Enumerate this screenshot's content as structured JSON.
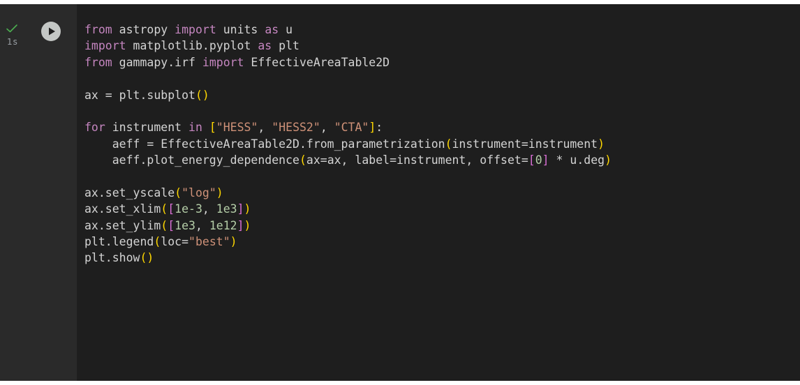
{
  "cell": {
    "status": "success",
    "exec_time": "1s",
    "run_button_icon": "play-icon",
    "check_icon": "check-icon",
    "colors": {
      "background": "#1e1e1e",
      "gutter": "#2a2a2a",
      "keyword": "#c586c0",
      "string": "#ce9178",
      "number": "#b5cea8",
      "bracket_level1": "#ffd700",
      "bracket_level2": "#da70d6",
      "check": "#4caf50"
    },
    "code_lines": [
      [
        {
          "t": "kw",
          "v": "from"
        },
        {
          "t": "id",
          "v": " astropy "
        },
        {
          "t": "kw",
          "v": "import"
        },
        {
          "t": "id",
          "v": " units "
        },
        {
          "t": "kw",
          "v": "as"
        },
        {
          "t": "id",
          "v": " u"
        }
      ],
      [
        {
          "t": "kw",
          "v": "import"
        },
        {
          "t": "id",
          "v": " matplotlib.pyplot "
        },
        {
          "t": "kw",
          "v": "as"
        },
        {
          "t": "id",
          "v": " plt"
        }
      ],
      [
        {
          "t": "kw",
          "v": "from"
        },
        {
          "t": "id",
          "v": " gammapy.irf "
        },
        {
          "t": "kw",
          "v": "import"
        },
        {
          "t": "id",
          "v": " EffectiveAreaTable2D"
        }
      ],
      [],
      [
        {
          "t": "id",
          "v": "ax = plt.subplot"
        },
        {
          "t": "br1",
          "v": "()"
        }
      ],
      [],
      [
        {
          "t": "kw",
          "v": "for"
        },
        {
          "t": "id",
          "v": " instrument "
        },
        {
          "t": "kw",
          "v": "in"
        },
        {
          "t": "id",
          "v": " "
        },
        {
          "t": "br1",
          "v": "["
        },
        {
          "t": "str",
          "v": "\"HESS\""
        },
        {
          "t": "id",
          "v": ", "
        },
        {
          "t": "str",
          "v": "\"HESS2\""
        },
        {
          "t": "id",
          "v": ", "
        },
        {
          "t": "str",
          "v": "\"CTA\""
        },
        {
          "t": "br1",
          "v": "]"
        },
        {
          "t": "id",
          "v": ":"
        }
      ],
      [
        {
          "t": "id",
          "v": "    aeff = EffectiveAreaTable2D.from_parametrization"
        },
        {
          "t": "br1",
          "v": "("
        },
        {
          "t": "id",
          "v": "instrument=instrument"
        },
        {
          "t": "br1",
          "v": ")"
        }
      ],
      [
        {
          "t": "id",
          "v": "    aeff.plot_energy_dependence"
        },
        {
          "t": "br1",
          "v": "("
        },
        {
          "t": "id",
          "v": "ax=ax, label=instrument, offset="
        },
        {
          "t": "br2",
          "v": "["
        },
        {
          "t": "num",
          "v": "0"
        },
        {
          "t": "br2",
          "v": "]"
        },
        {
          "t": "id",
          "v": " * u.deg"
        },
        {
          "t": "br1",
          "v": ")"
        }
      ],
      [],
      [
        {
          "t": "id",
          "v": "ax.set_yscale"
        },
        {
          "t": "br1",
          "v": "("
        },
        {
          "t": "str",
          "v": "\"log\""
        },
        {
          "t": "br1",
          "v": ")"
        }
      ],
      [
        {
          "t": "id",
          "v": "ax.set_xlim"
        },
        {
          "t": "br1",
          "v": "("
        },
        {
          "t": "br2",
          "v": "["
        },
        {
          "t": "num",
          "v": "1e-3"
        },
        {
          "t": "id",
          "v": ", "
        },
        {
          "t": "num",
          "v": "1e3"
        },
        {
          "t": "br2",
          "v": "]"
        },
        {
          "t": "br1",
          "v": ")"
        }
      ],
      [
        {
          "t": "id",
          "v": "ax.set_ylim"
        },
        {
          "t": "br1",
          "v": "("
        },
        {
          "t": "br2",
          "v": "["
        },
        {
          "t": "num",
          "v": "1e3"
        },
        {
          "t": "id",
          "v": ", "
        },
        {
          "t": "num",
          "v": "1e12"
        },
        {
          "t": "br2",
          "v": "]"
        },
        {
          "t": "br1",
          "v": ")"
        }
      ],
      [
        {
          "t": "id",
          "v": "plt.legend"
        },
        {
          "t": "br1",
          "v": "("
        },
        {
          "t": "id",
          "v": "loc="
        },
        {
          "t": "str",
          "v": "\"best\""
        },
        {
          "t": "br1",
          "v": ")"
        }
      ],
      [
        {
          "t": "id",
          "v": "plt.show"
        },
        {
          "t": "br1",
          "v": "()"
        }
      ]
    ]
  }
}
